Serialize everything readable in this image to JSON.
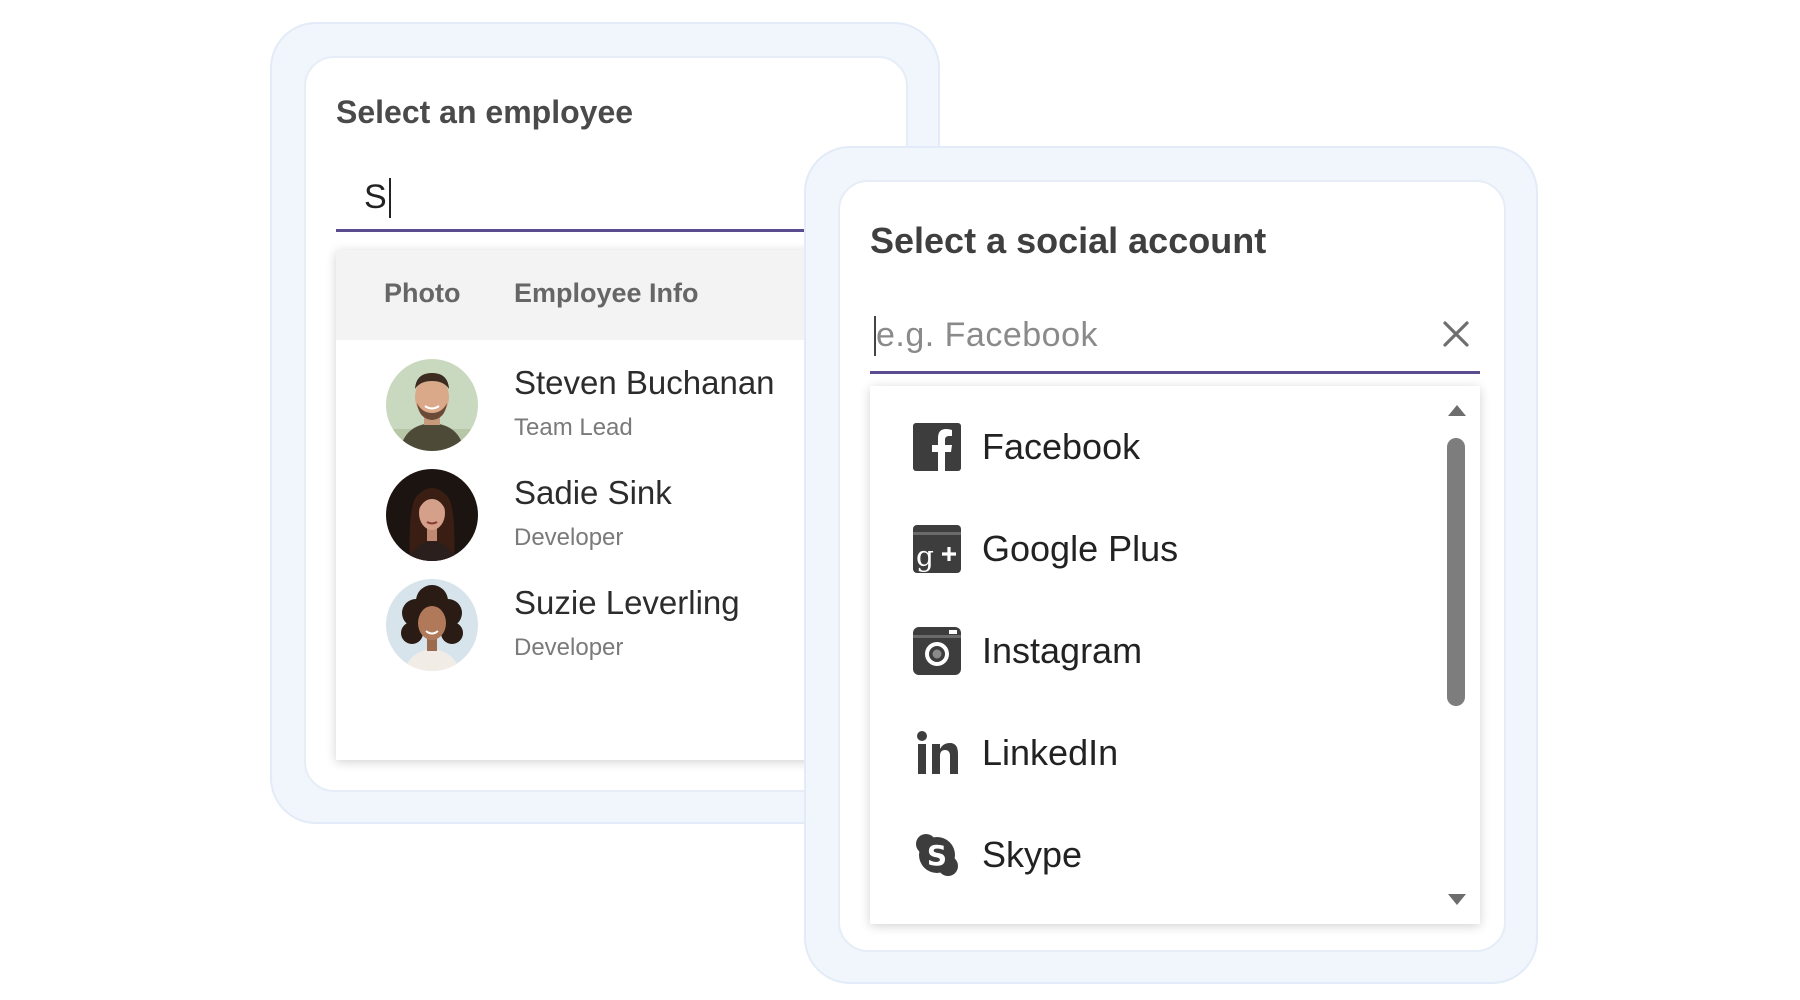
{
  "employee_picker": {
    "title": "Select an employee",
    "input_value": "S",
    "headers": {
      "photo": "Photo",
      "info": "Employee Info"
    },
    "employees": [
      {
        "name": "Steven Buchanan",
        "role": "Team Lead",
        "avatar": "man-avatar"
      },
      {
        "name": "Sadie Sink",
        "role": "Developer",
        "avatar": "woman-avatar-dark"
      },
      {
        "name": "Suzie Leverling",
        "role": "Developer",
        "avatar": "woman-avatar-curly"
      }
    ]
  },
  "social_picker": {
    "title": "Select a social account",
    "placeholder": "e.g. Facebook",
    "clear_icon": "close-icon",
    "items": [
      {
        "label": "Facebook",
        "icon": "facebook-icon"
      },
      {
        "label": "Google Plus",
        "icon": "google-plus-icon"
      },
      {
        "label": "Instagram",
        "icon": "instagram-icon"
      },
      {
        "label": "LinkedIn",
        "icon": "linkedin-icon"
      },
      {
        "label": "Skype",
        "icon": "skype-icon"
      }
    ]
  },
  "colors": {
    "accent_underline": "#5b4b8f",
    "frame_background": "#f1f6fd",
    "header_background": "#f3f3f3",
    "icon_color": "#3d3d3d"
  }
}
